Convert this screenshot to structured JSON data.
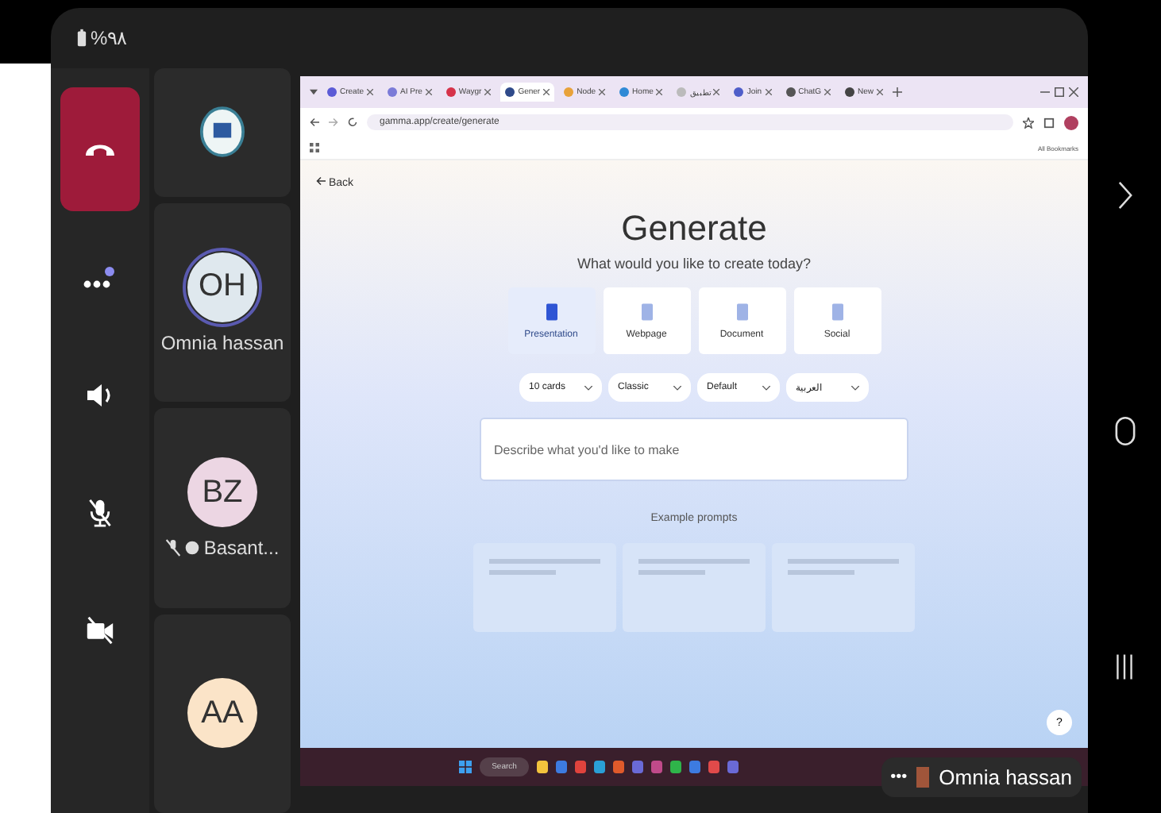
{
  "status_bar": {
    "battery": "%٩٨"
  },
  "call_controls": [
    {
      "kind": "hangup"
    },
    {
      "kind": "more",
      "badge": true
    },
    {
      "kind": "speaker"
    },
    {
      "kind": "mic-off"
    },
    {
      "kind": "camera-off"
    }
  ],
  "participants": [
    {
      "kind": "logo"
    },
    {
      "kind": "avatar",
      "initials": "OH",
      "name": "Omnia hassan",
      "color": "#dfe8ee",
      "speaking": true,
      "muted": false
    },
    {
      "kind": "avatar",
      "initials": "BZ",
      "name": "Basant...",
      "color": "#ecd6e3",
      "speaking": false,
      "muted": true
    },
    {
      "kind": "avatar",
      "initials": "AA",
      "color": "#fbe4c8",
      "speaking": false,
      "muted": false
    }
  ],
  "browser": {
    "tabs": [
      {
        "label": "Create",
        "selected": false,
        "color": "#5b5bd6"
      },
      {
        "label": "AI Pre",
        "selected": false,
        "color": "#7b7bd8"
      },
      {
        "label": "Waygr",
        "selected": false,
        "color": "#d6334a"
      },
      {
        "label": "Gener",
        "selected": true,
        "color": "#2f4a8a"
      },
      {
        "label": "Node",
        "selected": false,
        "color": "#e8a23a"
      },
      {
        "label": "Home",
        "selected": false,
        "color": "#2f8ad6"
      },
      {
        "label": "تطبيق",
        "selected": false,
        "color": "#bbbbbb"
      },
      {
        "label": "Join",
        "selected": false,
        "color": "#4f5ec9"
      },
      {
        "label": "ChatG",
        "selected": false,
        "color": "#555555"
      },
      {
        "label": "New",
        "selected": false,
        "color": "#444444"
      }
    ],
    "address": "gamma.app/create/generate",
    "bookmarks": "All Bookmarks"
  },
  "page": {
    "back": "Back",
    "title": "Generate",
    "subtitle": "What would you like to create today?",
    "types": [
      {
        "label": "Presentation",
        "selected": true
      },
      {
        "label": "Webpage",
        "selected": false
      },
      {
        "label": "Document",
        "selected": false
      },
      {
        "label": "Social",
        "selected": false
      }
    ],
    "options": [
      "10 cards",
      "Classic",
      "Default",
      "العربية"
    ],
    "prompt_placeholder": "Describe what you'd like to make",
    "examples_label": "Example prompts",
    "help": "?"
  },
  "taskbar": {
    "search": "Search",
    "apps": [
      {
        "color": "#f3c33d"
      },
      {
        "color": "#3d7be0"
      },
      {
        "color": "#e0433d"
      },
      {
        "color": "#2a9fd6"
      },
      {
        "color": "#e05a2b"
      },
      {
        "color": "#6a6ad6"
      },
      {
        "color": "#c04a8a"
      },
      {
        "color": "#2fb44a"
      },
      {
        "color": "#3d7be0"
      },
      {
        "color": "#e04a4a"
      },
      {
        "color": "#6a6ad6"
      }
    ]
  },
  "presenter_tag": {
    "dots": "•••",
    "name": "Omnia hassan"
  }
}
